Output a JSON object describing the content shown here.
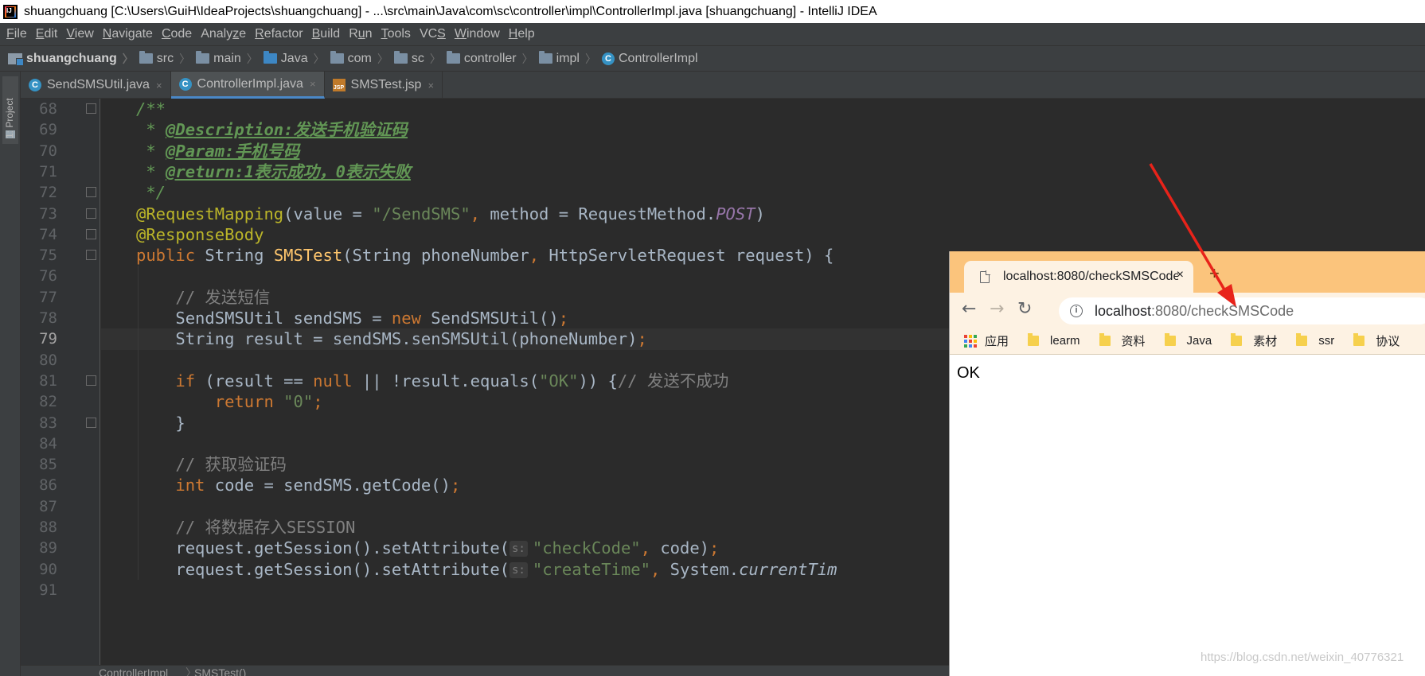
{
  "window": {
    "title": "shuangchuang [C:\\Users\\GuiH\\IdeaProjects\\shuangchuang] - ...\\src\\main\\Java\\com\\sc\\controller\\impl\\ControllerImpl.java [shuangchuang] - IntelliJ IDEA",
    "logo_text": "IJ"
  },
  "menubar": [
    {
      "mn": "F",
      "rest": "ile"
    },
    {
      "mn": "E",
      "rest": "dit"
    },
    {
      "mn": "V",
      "rest": "iew"
    },
    {
      "mn": "N",
      "rest": "avigate"
    },
    {
      "mn": "C",
      "rest": "ode"
    },
    {
      "pre": "Analy",
      "mn": "z",
      "rest": "e"
    },
    {
      "mn": "R",
      "rest": "efactor"
    },
    {
      "mn": "B",
      "rest": "uild"
    },
    {
      "pre": "R",
      "mn": "u",
      "rest": "n"
    },
    {
      "mn": "T",
      "rest": "ools"
    },
    {
      "pre": "VC",
      "mn": "S",
      "rest": ""
    },
    {
      "mn": "W",
      "rest": "indow"
    },
    {
      "mn": "H",
      "rest": "elp"
    }
  ],
  "breadcrumbs": [
    {
      "label": "shuangchuang",
      "icon": "module-icon"
    },
    {
      "label": "src",
      "icon": "folder-icon"
    },
    {
      "label": "main",
      "icon": "folder-icon"
    },
    {
      "label": "Java",
      "icon": "source-folder-icon"
    },
    {
      "label": "com",
      "icon": "package-icon"
    },
    {
      "label": "sc",
      "icon": "package-icon"
    },
    {
      "label": "controller",
      "icon": "package-icon"
    },
    {
      "label": "impl",
      "icon": "package-icon"
    },
    {
      "label": "ControllerImpl",
      "icon": "class-icon"
    }
  ],
  "side_tool": {
    "project_label": "1: Project"
  },
  "tabs": [
    {
      "label": "SendSMSUtil.java",
      "icon": "class-icon",
      "active": false
    },
    {
      "label": "ControllerImpl.java",
      "icon": "class-icon",
      "active": true
    },
    {
      "label": "SMSTest.jsp",
      "icon": "jsp-file-icon",
      "active": false
    }
  ],
  "tab_close_glyph": "×",
  "editor": {
    "current_line": 79,
    "param_hint": "s:",
    "lines": [
      {
        "n": 68,
        "html": "<span class=\"dc\">/**</span>"
      },
      {
        "n": 69,
        "html": "<span class=\"dc\"> * </span><span class=\"dt\">@Description:发送手机验证码</span>"
      },
      {
        "n": 70,
        "html": "<span class=\"dc\"> * </span><span class=\"dt\">@Param:手机号码</span>"
      },
      {
        "n": 71,
        "html": "<span class=\"dc\"> * </span><span class=\"dt\">@return:1表示成功，0表示失败</span>"
      },
      {
        "n": 72,
        "html": "<span class=\"dc\"> */</span>"
      },
      {
        "n": 73,
        "html": "<span class=\"a\">@RequestMapping</span>(value = <span class=\"s\">\"/SendSMS\"</span><span class=\"k\">, </span>method = RequestMethod.<span class=\"st\">POST</span>)"
      },
      {
        "n": 74,
        "html": "<span class=\"a\">@ResponseBody</span>"
      },
      {
        "n": 75,
        "html": "<span class=\"k\">public </span>String <span class=\"m\">SMSTest</span>(String phoneNumber<span class=\"k\">, </span>HttpServletRequest request) {"
      },
      {
        "n": 76,
        "html": ""
      },
      {
        "n": 77,
        "html": "    <span class=\"c\">// 发送短信</span>"
      },
      {
        "n": 78,
        "html": "    SendSMSUtil sendSMS = <span class=\"k\">new </span>SendSMSUtil()<span class=\"k\">;</span>"
      },
      {
        "n": 79,
        "html": "    String result = sendSMS.senSMSUtil(phoneNumber)<span class=\"k\">;</span>"
      },
      {
        "n": 80,
        "html": ""
      },
      {
        "n": 81,
        "html": "    <span class=\"k\">if </span>(result == <span class=\"k\">null </span>|| !result.equals(<span class=\"s\">\"OK\"</span>)) {<span class=\"c\">// 发送不成功</span>"
      },
      {
        "n": 82,
        "html": "        <span class=\"k\">return </span><span class=\"s\">\"0\"</span><span class=\"k\">;</span>"
      },
      {
        "n": 83,
        "html": "    }"
      },
      {
        "n": 84,
        "html": ""
      },
      {
        "n": 85,
        "html": "    <span class=\"c\">// 获取验证码</span>"
      },
      {
        "n": 86,
        "html": "    <span class=\"k\">int </span>code = sendSMS.getCode()<span class=\"k\">;</span>"
      },
      {
        "n": 87,
        "html": ""
      },
      {
        "n": 88,
        "html": "    <span class=\"c\">// 将数据存入SESSION</span>"
      },
      {
        "n": 89,
        "html": "    request.getSession().setAttribute(<span class=\"hint\">s:</span><span class=\"s\">\"checkCode\"</span><span class=\"k\">, </span>code)<span class=\"k\">;</span>"
      },
      {
        "n": 90,
        "html": "    request.getSession().setAttribute(<span class=\"hint\">s:</span><span class=\"s\">\"createTime\"</span><span class=\"k\">, </span>System.<span class=\"it\">currentTim</span>"
      },
      {
        "n": 91,
        "html": ""
      }
    ],
    "fold_lines": [
      68,
      72,
      73,
      74,
      75,
      81,
      83
    ]
  },
  "editor_breadcrumbs": [
    "ControllerImpl",
    "SMSTest()"
  ],
  "browser": {
    "tab_title": "localhost:8080/checkSMSCode",
    "tab_close": "×",
    "new_tab": "+",
    "back": "←",
    "forward": "→",
    "reload": "↻",
    "info_glyph": "i",
    "url_host": "localhost",
    "url_rest": ":8080/checkSMSCode",
    "apps_label": "应用",
    "apps_colors": [
      "#ea4335",
      "#fbbc05",
      "#34a853",
      "#4285f4",
      "#ea4335",
      "#fbbc05",
      "#34a853",
      "#4285f4",
      "#ea4335"
    ],
    "bookmarks": [
      "learm",
      "资料",
      "Java",
      "素材",
      "ssr",
      "协议"
    ],
    "page_text": "OK",
    "tabstrip_color": "#fbc47c"
  },
  "watermark": "https://blog.csdn.net/weixin_40776321",
  "annotation": {
    "color": "#e8231a"
  }
}
